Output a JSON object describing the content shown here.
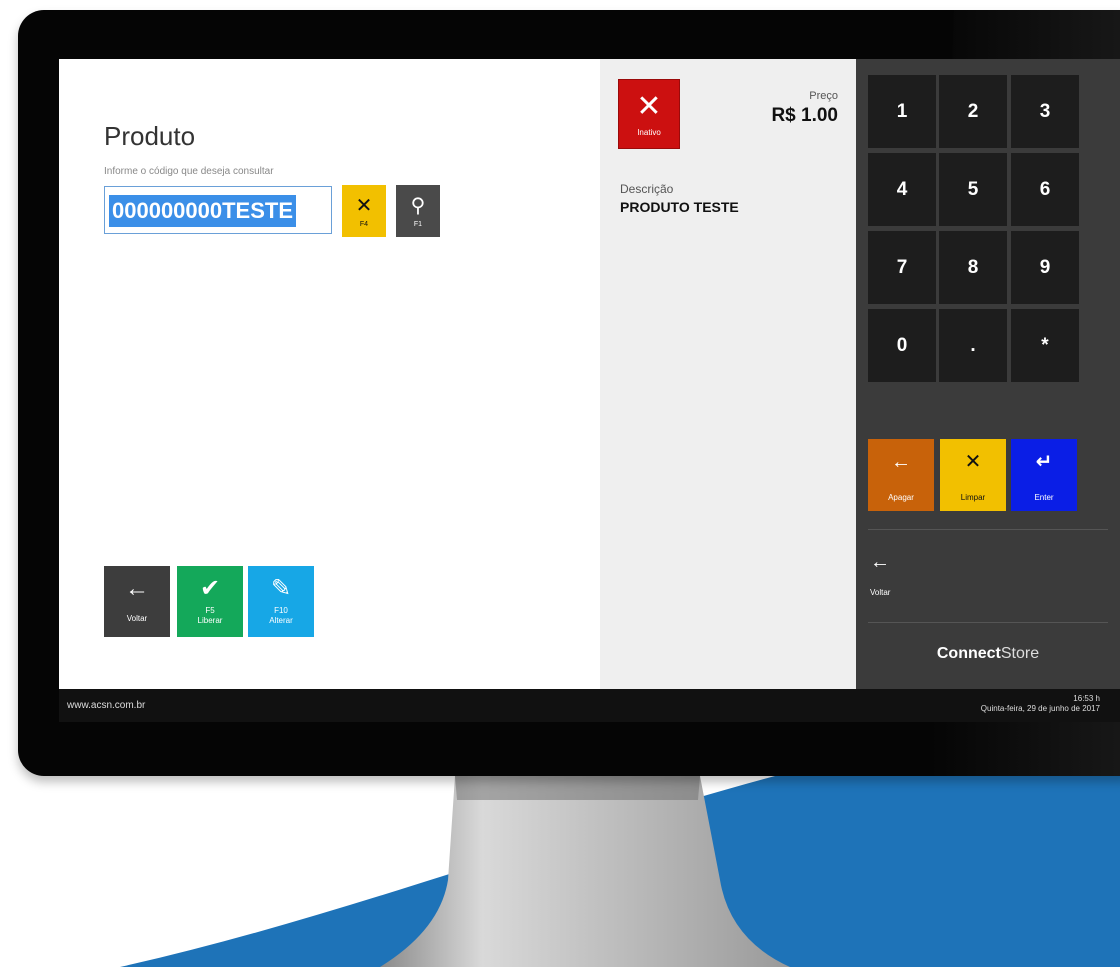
{
  "colors": {
    "yellow": "#f2c000",
    "dark_btn": "#3d3d3d",
    "green": "#14a85a",
    "blue": "#17a7e6",
    "red": "#cc1010",
    "orange": "#c8620a",
    "enter_blue": "#0a1ee6",
    "accent_bg": "#1e73b8"
  },
  "product": {
    "title": "Produto",
    "hint": "Informe o código que deseja consultar",
    "code_value": "000000000TESTE",
    "clear_btn": {
      "icon": "close-icon",
      "glyph": "✕",
      "label": "F4"
    },
    "search_btn": {
      "icon": "search-icon",
      "glyph": "⚲",
      "label": "F1"
    }
  },
  "actions": {
    "voltar": {
      "glyph": "←",
      "label": "Voltar"
    },
    "liberar": {
      "glyph": "✔",
      "key": "F5",
      "label": "Liberar"
    },
    "alterar": {
      "glyph": "✎",
      "key": "F10",
      "label": "Alterar"
    }
  },
  "details": {
    "status": {
      "glyph": "✕",
      "label": "Inativo"
    },
    "price_label": "Preço",
    "price_value": "R$ 1.00",
    "desc_label": "Descrição",
    "desc_value": "PRODUTO TESTE"
  },
  "keypad": {
    "keys": [
      "1",
      "2",
      "3",
      "4",
      "5",
      "6",
      "7",
      "8",
      "9",
      "0",
      ".",
      "*"
    ],
    "apagar": {
      "glyph": "←",
      "label": "Apagar"
    },
    "limpar": {
      "glyph": "✕",
      "label": "Limpar"
    },
    "enter": {
      "glyph": "↵",
      "label": "Enter"
    },
    "voltar": {
      "glyph": "←",
      "label": "Voltar"
    },
    "brand_bold": "Connect",
    "brand_light": "Store"
  },
  "status_bar": {
    "site": "www.acsn.com.br",
    "time": "16:53 h",
    "date": "Quinta-feira, 29 de junho de 2017"
  }
}
